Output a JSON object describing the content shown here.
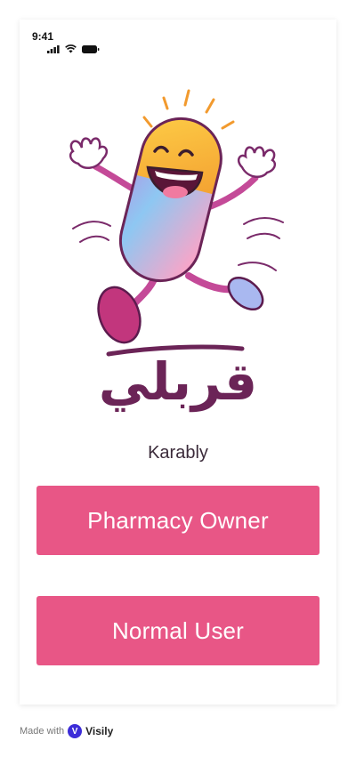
{
  "status_bar": {
    "time": "9:41",
    "icons": [
      "cellular-signal-icon",
      "wifi-icon",
      "battery-icon"
    ]
  },
  "branding": {
    "logo_arabic": "قربلي",
    "logo_latin": "Karably",
    "mascot": "happy-capsule-mascot-icon"
  },
  "actions": {
    "pharmacy_owner_label": "Pharmacy Owner",
    "normal_user_label": "Normal User"
  },
  "footer": {
    "made_with": "Made with",
    "brand": "Visily",
    "brand_icon": "visily-logo-icon"
  },
  "colors": {
    "button_bg": "#e85686",
    "logo": "#6b2457",
    "button_text": "#ffffff"
  }
}
